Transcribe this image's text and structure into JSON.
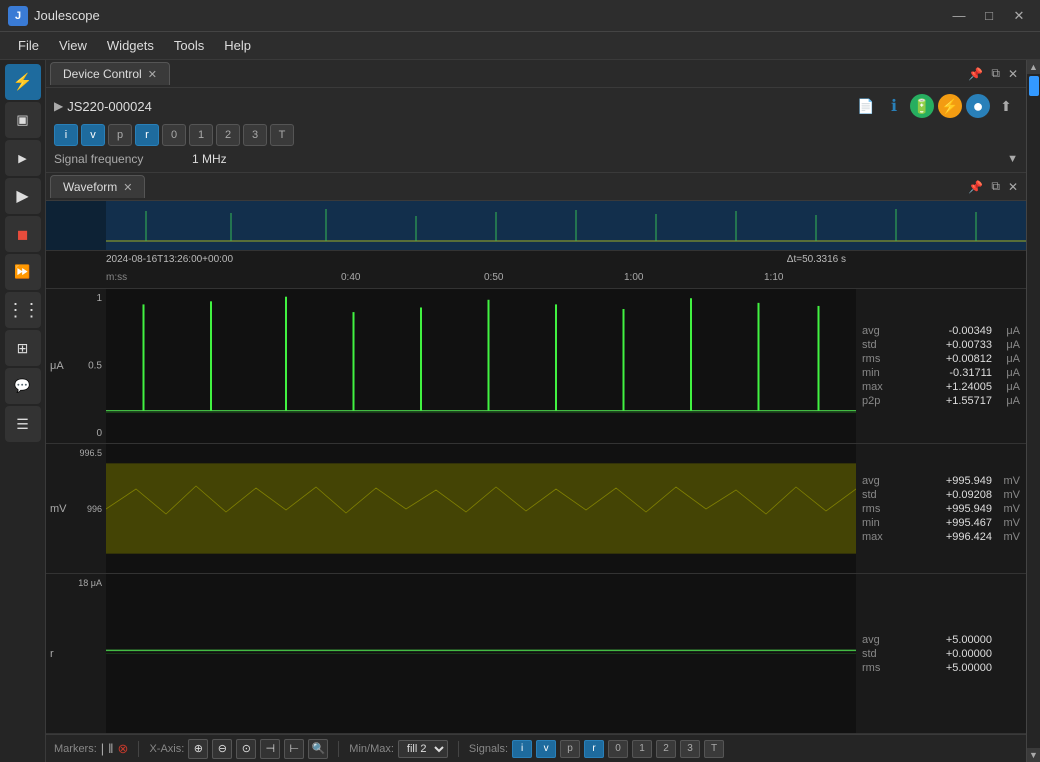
{
  "titlebar": {
    "app_icon": "J",
    "app_title": "Joulescope",
    "minimize": "—",
    "maximize": "□",
    "close": "✕"
  },
  "menubar": {
    "items": [
      "File",
      "View",
      "Widgets",
      "Tools",
      "Help"
    ]
  },
  "sidebar": {
    "buttons": [
      {
        "id": "lightning",
        "icon": "⚡",
        "active": true
      },
      {
        "id": "square",
        "icon": "▣",
        "active": false
      },
      {
        "id": "play-small",
        "icon": "▶",
        "active": false
      },
      {
        "id": "play",
        "icon": "▶",
        "active": false
      },
      {
        "id": "stop",
        "icon": "◼",
        "active": false
      },
      {
        "id": "forward",
        "icon": "⏩",
        "active": false
      },
      {
        "id": "layers",
        "icon": "⋮",
        "active": false
      },
      {
        "id": "grid",
        "icon": "⊞",
        "active": false
      },
      {
        "id": "chat",
        "icon": "💬",
        "active": false
      },
      {
        "id": "menu-lines",
        "icon": "☰",
        "active": false
      }
    ]
  },
  "device_control": {
    "tab_label": "Device Control",
    "device_name": "JS220-000024",
    "arrow": "▶",
    "signal_buttons": [
      {
        "label": "i",
        "active": true
      },
      {
        "label": "v",
        "active": true
      },
      {
        "label": "p",
        "active": false
      },
      {
        "label": "r",
        "active": true
      },
      {
        "label": "0",
        "active": false
      },
      {
        "label": "1",
        "active": false
      },
      {
        "label": "2",
        "active": false
      },
      {
        "label": "3",
        "active": false
      },
      {
        "label": "T",
        "active": false
      }
    ],
    "freq_label": "Signal frequency",
    "freq_value": "1 MHz",
    "icons": [
      {
        "id": "doc",
        "symbol": "📄",
        "style": "plain"
      },
      {
        "id": "info",
        "symbol": "ℹ",
        "style": "plain"
      },
      {
        "id": "battery",
        "symbol": "🔋",
        "style": "green"
      },
      {
        "id": "lightning2",
        "symbol": "⚡",
        "style": "yellow"
      },
      {
        "id": "circle",
        "symbol": "●",
        "style": "blue"
      },
      {
        "id": "upload",
        "symbol": "⬆",
        "style": "plain"
      }
    ]
  },
  "waveform": {
    "tab_label": "Waveform",
    "timestamp": "2024-08-16T13:26:00+00:00",
    "time_format": "m:ss",
    "time_labels": [
      "0:40",
      "0:50",
      "1:00",
      "1:10"
    ],
    "delta_t": "Δt=50.3316 s",
    "charts": [
      {
        "id": "current",
        "unit": "μA",
        "y_max": "1",
        "y_mid": "0.5",
        "y_zero": "0",
        "stats": [
          {
            "label": "avg",
            "value": "-0.00349",
            "unit": "μA"
          },
          {
            "label": "std",
            "value": "+0.00733",
            "unit": "μA"
          },
          {
            "label": "rms",
            "value": "+0.00812",
            "unit": "μA"
          },
          {
            "label": "min",
            "value": "-0.31711",
            "unit": "μA"
          },
          {
            "label": "max",
            "value": "+1.24005",
            "unit": "μA"
          },
          {
            "label": "p2p",
            "value": "+1.55717",
            "unit": "μA"
          }
        ]
      },
      {
        "id": "voltage",
        "unit": "mV",
        "y_max": "996.5",
        "y_mid": "996",
        "y_zero": "",
        "stats": [
          {
            "label": "avg",
            "value": "+995.949",
            "unit": "mV"
          },
          {
            "label": "std",
            "value": "+0.09208",
            "unit": "mV"
          },
          {
            "label": "rms",
            "value": "+995.949",
            "unit": "mV"
          },
          {
            "label": "min",
            "value": "+995.467",
            "unit": "mV"
          },
          {
            "label": "max",
            "value": "+996.424",
            "unit": "mV"
          }
        ]
      },
      {
        "id": "resistance",
        "unit": "r",
        "y_label": "18 μA",
        "stats": [
          {
            "label": "avg",
            "value": "+5.00000",
            "unit": ""
          },
          {
            "label": "std",
            "value": "+0.00000",
            "unit": ""
          },
          {
            "label": "rms",
            "value": "+5.00000",
            "unit": ""
          }
        ]
      }
    ]
  },
  "bottom_bar": {
    "markers_label": "Markers:",
    "marker1": "|",
    "marker2": "‖",
    "marker_del": "⊗",
    "xaxis_label": "X-Axis:",
    "zoom_in": "⊕",
    "zoom_out": "⊖",
    "zoom_fit": "⊙",
    "pan_left": "⊣",
    "pan_right": "⊢",
    "zoom_sel": "🔍",
    "minmax_label": "Min/Max:",
    "minmax_val": "fill 2",
    "signals_label": "Signals:",
    "signal_buttons": [
      {
        "label": "i",
        "active": true
      },
      {
        "label": "v",
        "active": true
      },
      {
        "label": "p",
        "active": false
      },
      {
        "label": "r",
        "active": true
      },
      {
        "label": "0",
        "active": false
      },
      {
        "label": "1",
        "active": false
      },
      {
        "label": "2",
        "active": false
      },
      {
        "label": "3",
        "active": false
      },
      {
        "label": "T",
        "active": false
      }
    ]
  }
}
